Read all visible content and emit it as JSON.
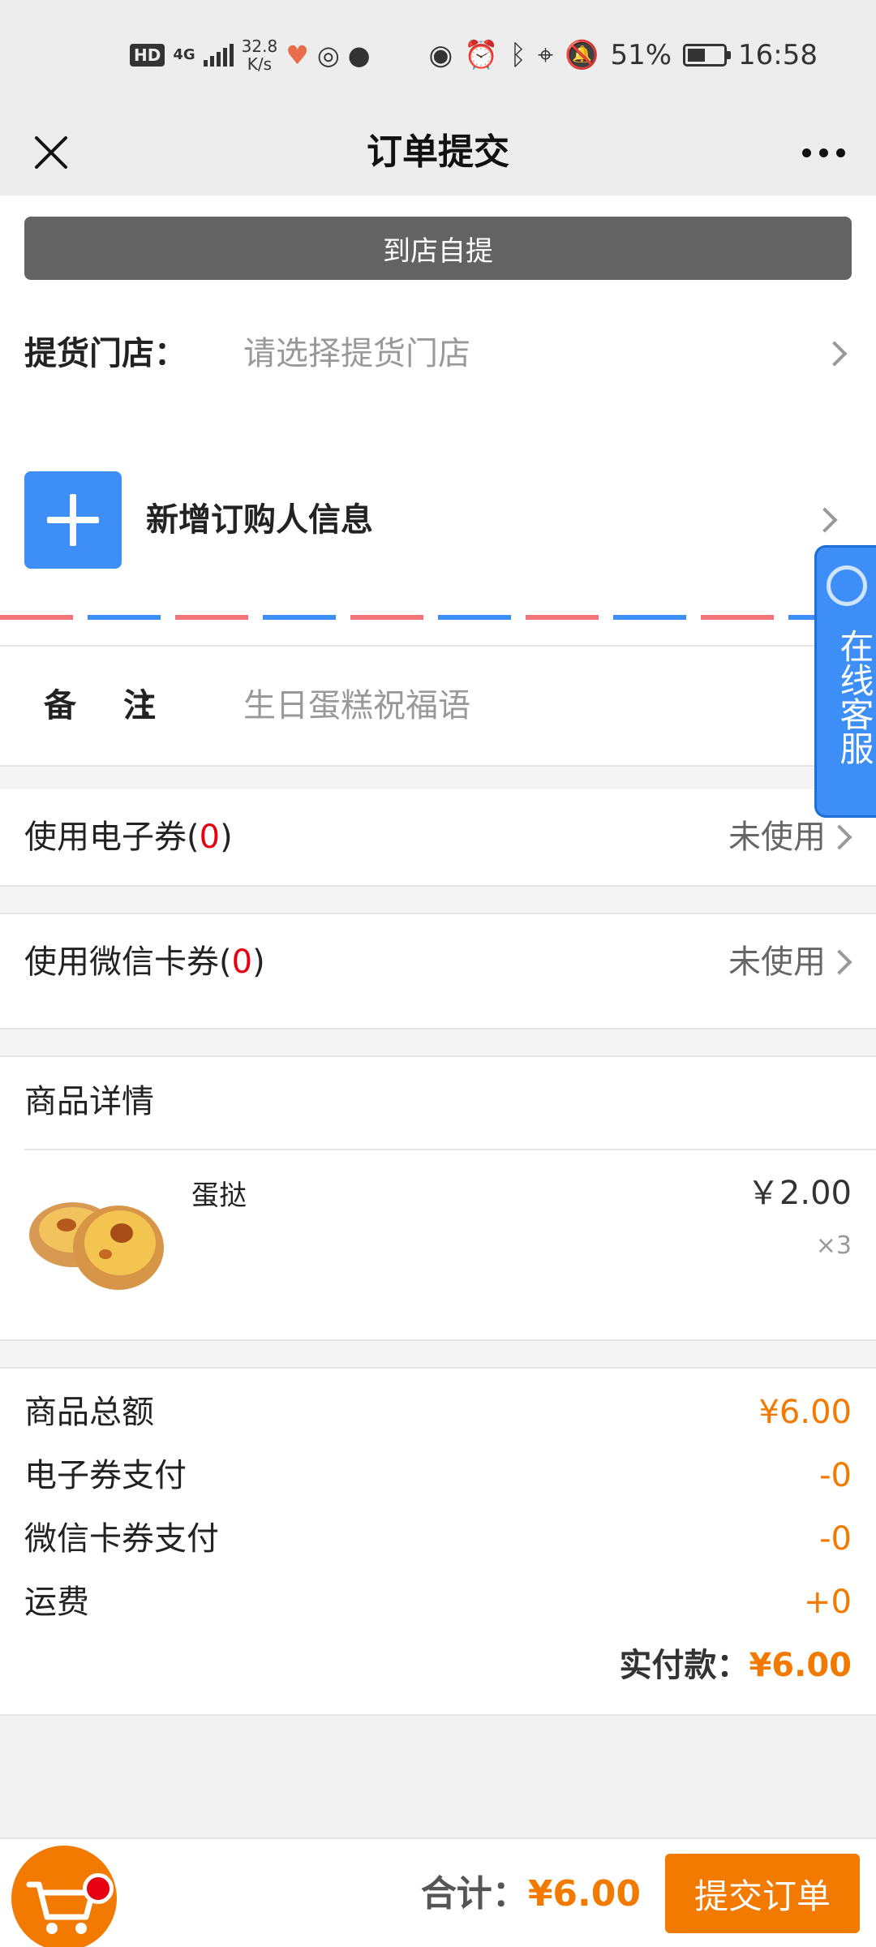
{
  "status_bar": {
    "hd": "HD",
    "network": "4G",
    "speed_value": "32.8",
    "speed_unit": "K/s",
    "battery": "51%",
    "battery_level": 0.51,
    "time": "16:58"
  },
  "header": {
    "title": "订单提交",
    "close_icon": "close-icon",
    "more_icon": "more-icon"
  },
  "pickup": {
    "button_label": "到店自提",
    "store_label": "提货门店：",
    "store_placeholder": "请选择提货门店"
  },
  "buyer": {
    "add_label": "新增订购人信息"
  },
  "remark": {
    "label": "备注",
    "colon": "：",
    "placeholder": "生日蛋糕祝福语"
  },
  "coupons": {
    "e_coupon": {
      "label_prefix": "使用电子券(",
      "count": "0",
      "label_suffix": ")",
      "status": "未使用"
    },
    "wechat_card": {
      "label_prefix": "使用微信卡券(",
      "count": "0",
      "label_suffix": ")",
      "status": "未使用"
    }
  },
  "product_section": {
    "title": "商品详情",
    "items": [
      {
        "name": "蛋挞",
        "price": "￥2.00",
        "quantity": "×3",
        "image": "egg-tart-image"
      }
    ]
  },
  "summary": {
    "rows": [
      {
        "label": "商品总额",
        "value": "¥6.00"
      },
      {
        "label": "电子券支付",
        "value": "-0"
      },
      {
        "label": "微信卡券支付",
        "value": "-0"
      },
      {
        "label": "运费",
        "value": "+0"
      }
    ],
    "actual_label": "实付款：",
    "actual_value": "¥6.00"
  },
  "service_widget": {
    "label": "在线客服"
  },
  "bottom_bar": {
    "total_label": "合计：",
    "total_value": "¥6.00",
    "submit_label": "提交订单"
  },
  "colors": {
    "accent_orange": "#f27a00",
    "accent_blue": "#3e8ef7",
    "stripe_red": "#f2747a",
    "count_red": "#e60012"
  }
}
